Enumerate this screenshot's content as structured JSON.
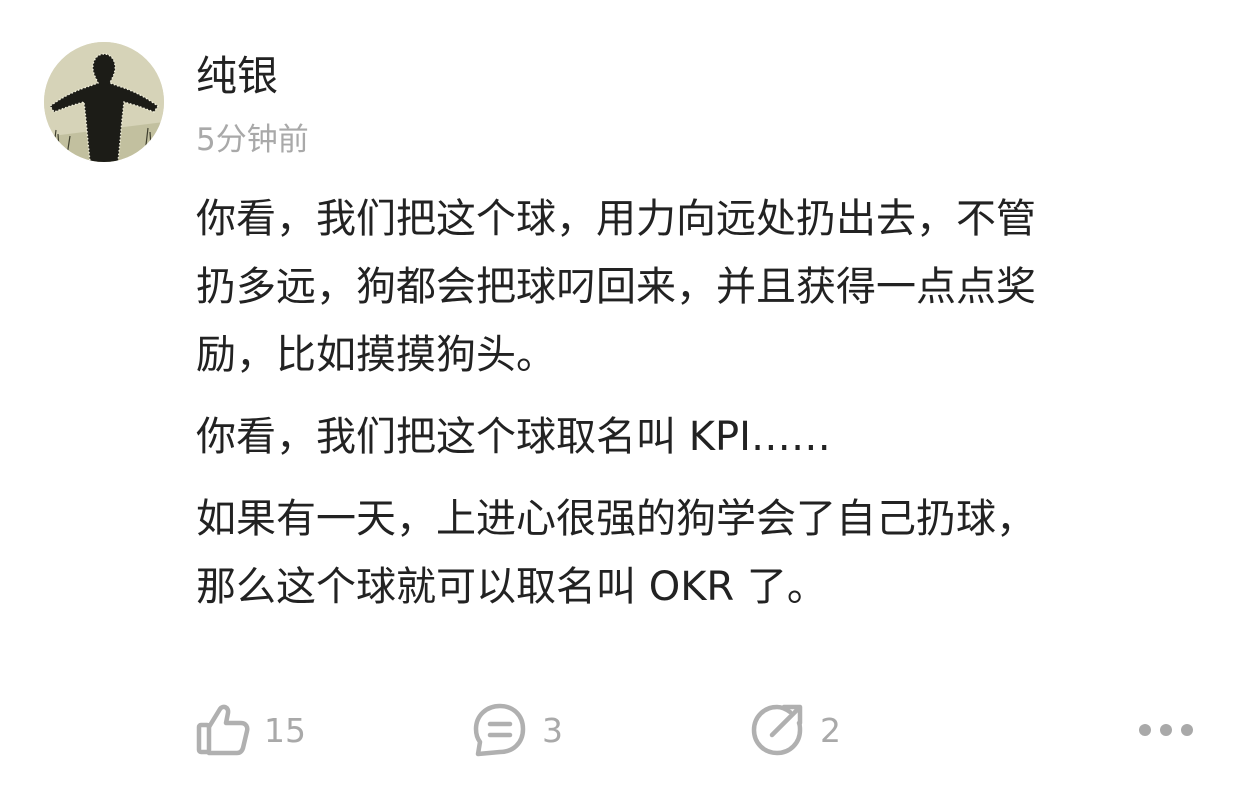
{
  "post": {
    "author": "纯银",
    "time": "5分钟前",
    "paragraphs": [
      "你看，我们把这个球，用力向远处扔出去，不管\n扔多远，狗都会把球叼回来，并且获得一点点奖\n励，比如摸摸狗头。",
      "你看，我们把这个球取名叫 KPI……",
      "如果有一天，上进心很强的狗学会了自己扔球，\n那么这个球就可以取名叫 OKR 了。"
    ]
  },
  "actions": {
    "like": {
      "icon": "thumbs-up-icon",
      "count": "15"
    },
    "comment": {
      "icon": "comment-bubble-icon",
      "count": "3"
    },
    "share": {
      "icon": "share-arrow-icon",
      "count": "2"
    },
    "more": {
      "icon": "more-dots-icon"
    }
  },
  "colors": {
    "text": "#222222",
    "muted": "#a9a9a9",
    "icon": "#b0b0b0"
  }
}
